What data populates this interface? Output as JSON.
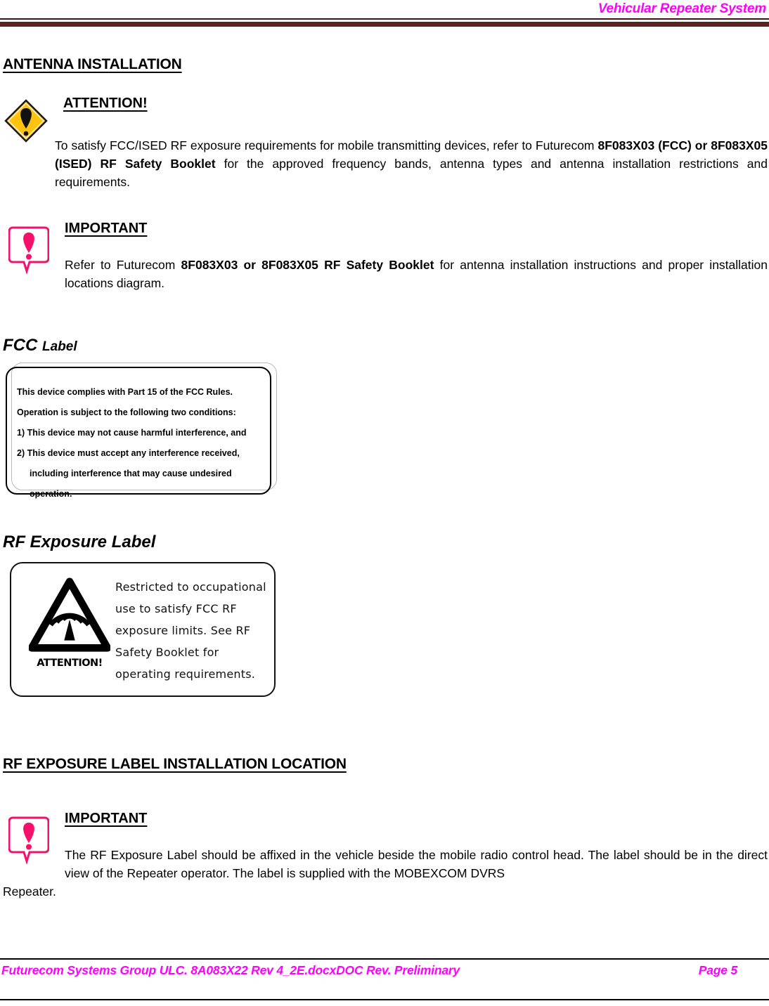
{
  "header": {
    "title": "Vehicular Repeater System"
  },
  "sections": {
    "antenna_installation": "ANTENNA INSTALLATION",
    "rf_exposure_label_location": "RF EXPOSURE LABEL INSTALLATION LOCATION",
    "fcc_label_heading_a": "FCC ",
    "fcc_label_heading_b": "Label",
    "rf_exposure_label_heading": "RF Exposure Label"
  },
  "attention_callout": {
    "icon": "attention-diamond-icon",
    "title": "ATTENTION!",
    "body_part1": "To satisfy FCC/ISED RF exposure requirements for mobile transmitting devices, refer to Futurecom ",
    "body_bold": "8F083X03 (FCC) or 8F083X05 (ISED) RF Safety Booklet",
    "body_part2": " for the approved frequency bands, antenna types and antenna installation restrictions and requirements."
  },
  "important_callout_1": {
    "icon": "important-bubble-icon",
    "title": "IMPORTANT",
    "body_part1": "Refer to Futurecom ",
    "body_bold": "8F083X03 or 8F083X05 RF Safety Booklet",
    "body_part2": " for antenna installation instructions and proper installation locations diagram."
  },
  "important_callout_2": {
    "icon": "important-bubble-icon",
    "title": "IMPORTANT",
    "body": "The RF Exposure Label should be affixed in the vehicle beside the mobile radio control head. The label should be in the direct view of the Repeater operator.  The label is supplied with the MOBEXCOM DVRS",
    "body_overflow": "Repeater."
  },
  "fcc_label": {
    "lines": [
      "This device complies with Part 15 of the FCC Rules.",
      "Operation is subject to the following two conditions:",
      "1) This device may not cause harmful interference, and",
      "2) This device must accept any interference received,",
      "including interference that may cause undesired",
      "operation."
    ]
  },
  "rf_exposure_label": {
    "icon": "rf-radiation-triangle-icon",
    "caption": "ATTENTION!",
    "text": "Restricted to occupational use to satisfy FCC RF exposure limits. See RF Safety Booklet for operating requirements."
  },
  "footer": {
    "left": "Futurecom Systems Group ULC. 8A083X22 Rev 4_2E.docxDOC Rev. Preliminary",
    "right": "Page 5"
  },
  "colors": {
    "accent_magenta": "#FF00FF",
    "header_rule_dark": "#5c2323",
    "attention_yellow": "#FFC20E",
    "important_pink": "#F5106B"
  }
}
